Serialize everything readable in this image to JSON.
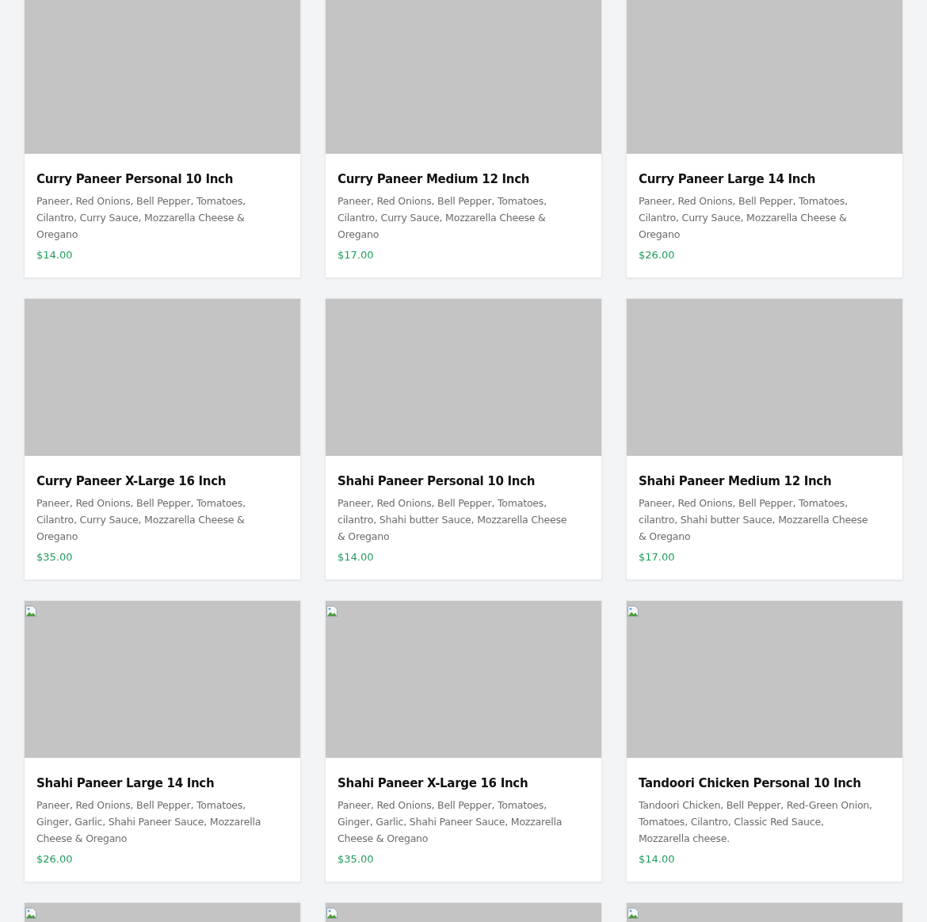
{
  "products": [
    {
      "name": "Curry Paneer Personal 10 Inch",
      "description": "Paneer, Red Onions, Bell Pepper, Tomatoes, Cilantro, Curry Sauce, Mozzarella Cheese & Oregano",
      "price": "$14.00",
      "broken_image": false
    },
    {
      "name": "Curry Paneer Medium 12 Inch",
      "description": "Paneer, Red Onions, Bell Pepper, Tomatoes, Cilantro, Curry Sauce, Mozzarella Cheese & Oregano",
      "price": "$17.00",
      "broken_image": false
    },
    {
      "name": "Curry Paneer Large 14 Inch",
      "description": "Paneer, Red Onions, Bell Pepper, Tomatoes, Cilantro, Curry Sauce, Mozzarella Cheese & Oregano",
      "price": "$26.00",
      "broken_image": false
    },
    {
      "name": "Curry Paneer X-Large 16 Inch",
      "description": "Paneer, Red Onions, Bell Pepper, Tomatoes, Cilantro, Curry Sauce, Mozzarella Cheese & Oregano",
      "price": "$35.00",
      "broken_image": false
    },
    {
      "name": "Shahi Paneer Personal 10 Inch",
      "description": "Paneer, Red Onions, Bell Pepper, Tomatoes, cilantro, Shahi butter Sauce, Mozzarella Cheese & Oregano",
      "price": "$14.00",
      "broken_image": false
    },
    {
      "name": "Shahi Paneer Medium 12 Inch",
      "description": "Paneer, Red Onions, Bell Pepper, Tomatoes, cilantro, Shahi butter Sauce, Mozzarella Cheese & Oregano",
      "price": "$17.00",
      "broken_image": false
    },
    {
      "name": "Shahi Paneer Large 14 Inch",
      "description": "Paneer, Red Onions, Bell Pepper, Tomatoes, Ginger, Garlic, Shahi Paneer Sauce, Mozzarella Cheese & Oregano",
      "price": "$26.00",
      "broken_image": true
    },
    {
      "name": "Shahi Paneer X-Large 16 Inch",
      "description": "Paneer, Red Onions, Bell Pepper, Tomatoes, Ginger, Garlic, Shahi Paneer Sauce, Mozzarella Cheese & Oregano",
      "price": "$35.00",
      "broken_image": true
    },
    {
      "name": "Tandoori Chicken Personal 10 Inch",
      "description": "Tandoori Chicken, Bell Pepper, Red-Green Onion, Tomatoes, Cilantro, Classic Red Sauce, Mozzarella cheese.",
      "price": "$14.00",
      "broken_image": true
    },
    {
      "broken_image": true
    },
    {
      "broken_image": true
    },
    {
      "broken_image": true
    }
  ]
}
